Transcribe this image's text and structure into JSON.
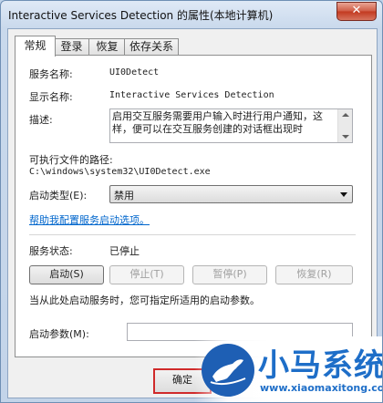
{
  "window": {
    "title": "Interactive Services Detection 的属性(本地计算机)",
    "close_label": "✕"
  },
  "tabs": [
    {
      "label": "常规",
      "active": true
    },
    {
      "label": "登录",
      "active": false
    },
    {
      "label": "恢复",
      "active": false
    },
    {
      "label": "依存关系",
      "active": false
    }
  ],
  "general": {
    "service_name_label": "服务名称:",
    "service_name_value": "UI0Detect",
    "display_name_label": "显示名称:",
    "display_name_value": "Interactive Services Detection",
    "description_label": "描述:",
    "description_value": "启用交互服务需要用户输入时进行用户通知，这样，便可以在交互服务创建的对话框出现时",
    "exe_path_label": "可执行文件的路径:",
    "exe_path_value": "C:\\windows\\system32\\UI0Detect.exe",
    "startup_type_label": "启动类型(E):",
    "startup_type_value": "禁用",
    "help_link": "帮助我配置服务启动选项。",
    "status_label": "服务状态:",
    "status_value": "已停止",
    "buttons": {
      "start": "启动(S)",
      "stop": "停止(T)",
      "pause": "暂停(P)",
      "resume": "恢复(R)"
    },
    "hint_text": "当从此处启动服务时，您可指定所适用的启动参数。",
    "start_params_label": "启动参数(M):",
    "start_params_value": ""
  },
  "footer": {
    "ok_label": "确定"
  },
  "watermark": {
    "text": "小马系统",
    "url": "www.xiaomaxitong.com"
  },
  "colors": {
    "link": "#0066cc",
    "close": "#c2391f",
    "watermark": "#1e6ec8",
    "highlight": "#d02a2a"
  }
}
